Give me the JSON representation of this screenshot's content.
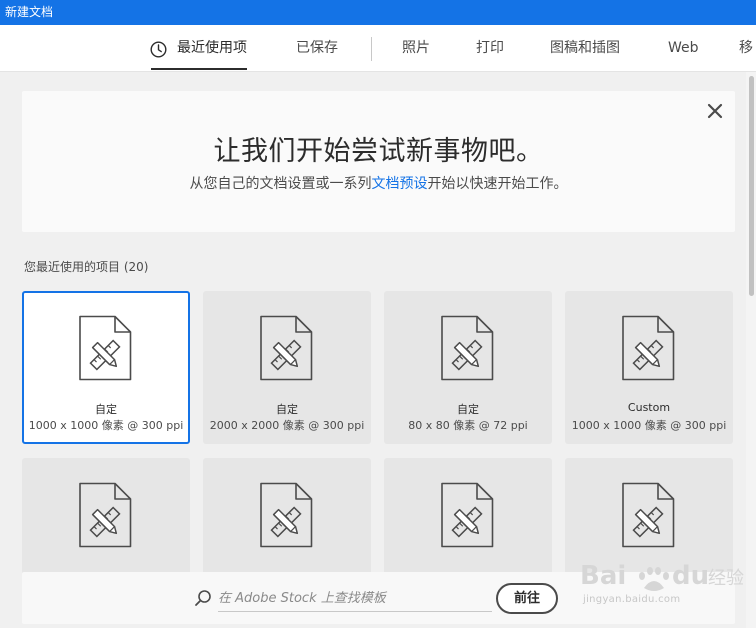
{
  "window": {
    "title": "新建文档"
  },
  "tabs": [
    {
      "label": "最近使用项",
      "active": true
    },
    {
      "label": "已保存"
    },
    {
      "label": "照片"
    },
    {
      "label": "打印"
    },
    {
      "label": "图稿和插图"
    },
    {
      "label": "Web"
    },
    {
      "label": "移"
    }
  ],
  "banner": {
    "title": "让我们开始尝试新事物吧。",
    "subtitle_before": "从您自己的文档设置或一系列",
    "subtitle_link": "文档预设",
    "subtitle_after": "开始以快速开始工作。",
    "close_icon": "close-icon"
  },
  "recent": {
    "heading": "您最近使用的项目",
    "count": "(20)",
    "items": [
      {
        "name": "自定",
        "dims": "1000 x 1000 像素 @ 300 ppi",
        "selected": true
      },
      {
        "name": "自定",
        "dims": "2000 x 2000 像素 @ 300 ppi"
      },
      {
        "name": "自定",
        "dims": "80 x 80 像素 @ 72 ppi"
      },
      {
        "name": "Custom",
        "dims": "1000 x 1000 像素 @ 300 ppi"
      },
      {
        "name": "",
        "dims": ""
      },
      {
        "name": "",
        "dims": ""
      },
      {
        "name": "",
        "dims": ""
      },
      {
        "name": "",
        "dims": ""
      }
    ]
  },
  "stock": {
    "placeholder": "在 Adobe Stock 上查找模板",
    "go_label": "前往"
  },
  "watermark": {
    "text": "jingyan.baidu.com",
    "logo_text": "Bai du 经验"
  },
  "colors": {
    "accent": "#1473e6",
    "titlebar": "#1473e6"
  }
}
